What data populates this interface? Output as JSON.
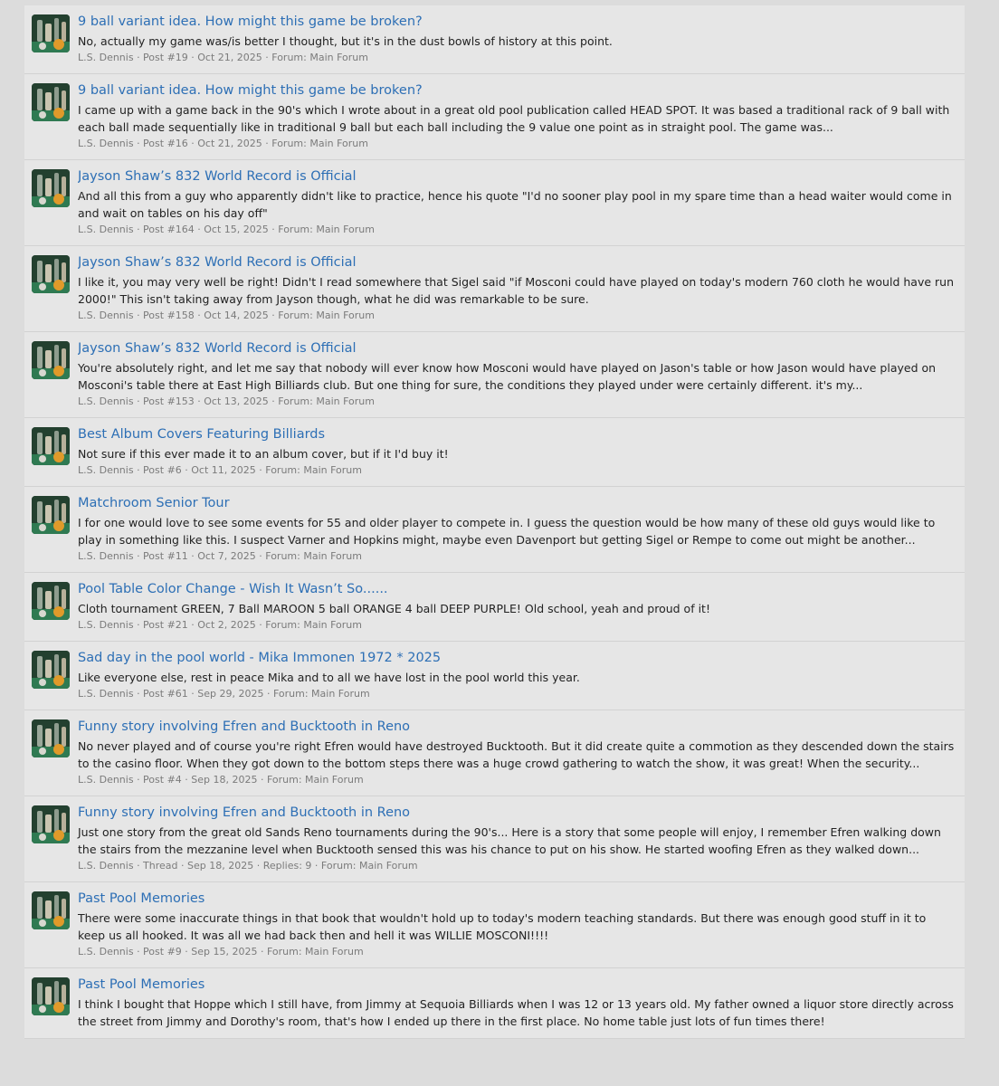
{
  "results": [
    {
      "title": "9 ball variant idea. How might this game be broken?",
      "snippet": "No, actually my game was/is better I thought, but it's in the dust bowls of history at this point.",
      "meta": "L.S. Dennis · Post #19 · Oct 21, 2025 · Forum: Main Forum"
    },
    {
      "title": "9 ball variant idea. How might this game be broken?",
      "snippet": "I came up with a game back in the 90's which I wrote about in a great old pool publication called HEAD SPOT. It was based a traditional rack of 9 ball with each ball made sequentially like in traditional 9 ball but each ball including the 9 value one point as in straight pool. The game was...",
      "meta": "L.S. Dennis · Post #16 · Oct 21, 2025 · Forum: Main Forum"
    },
    {
      "title": "Jayson Shaw’s 832 World Record is Official",
      "snippet": "And all this from a guy who apparently didn't like to practice, hence his quote \"I'd no sooner play pool in my spare time than a head waiter would come in and wait on tables on his day off\"",
      "meta": "L.S. Dennis · Post #164 · Oct 15, 2025 · Forum: Main Forum"
    },
    {
      "title": "Jayson Shaw’s 832 World Record is Official",
      "snippet": "I like it, you may very well be right! Didn't I read somewhere that Sigel said \"if Mosconi could have played on today's modern 760 cloth he would have run 2000!\" This isn't taking away from Jayson though, what he did was remarkable to be sure.",
      "meta": "L.S. Dennis · Post #158 · Oct 14, 2025 · Forum: Main Forum"
    },
    {
      "title": "Jayson Shaw’s 832 World Record is Official",
      "snippet": "You're absolutely right, and let me say that nobody will ever know how Mosconi would have played on Jason's table or how Jason would have played on Mosconi's table there at East High Billiards club. But one thing for sure, the conditions they played under were certainly different. it's my...",
      "meta": "L.S. Dennis · Post #153 · Oct 13, 2025 · Forum: Main Forum"
    },
    {
      "title": "Best Album Covers Featuring Billiards",
      "snippet": "Not sure if this ever made it to an album cover, but if it I'd buy it!",
      "meta": "L.S. Dennis · Post #6 · Oct 11, 2025 · Forum: Main Forum"
    },
    {
      "title": "Matchroom Senior Tour",
      "snippet": "I for one would love to see some events for 55 and older player to compete in. I guess the question would be how many of these old guys would like to play in something like this. I suspect Varner and Hopkins might, maybe even Davenport but getting Sigel or Rempe to come out might be another...",
      "meta": "L.S. Dennis · Post #11 · Oct 7, 2025 · Forum: Main Forum"
    },
    {
      "title": "Pool Table Color Change - Wish It Wasn’t So......",
      "snippet": "Cloth tournament GREEN, 7 Ball MAROON 5 ball ORANGE 4 ball DEEP PURPLE! Old school, yeah and proud of it!",
      "meta": "L.S. Dennis · Post #21 · Oct 2, 2025 · Forum: Main Forum"
    },
    {
      "title": "Sad day in the pool world - Mika Immonen 1972 * 2025",
      "snippet": "Like everyone else, rest in peace Mika and to all we have lost in the pool world this year.",
      "meta": "L.S. Dennis · Post #61 · Sep 29, 2025 · Forum: Main Forum"
    },
    {
      "title": "Funny story involving Efren and Bucktooth in Reno",
      "snippet": "No never played and of course you're right Efren would have destroyed Bucktooth. But it did create quite a commotion as they descended down the stairs to the casino floor. When they got down to the bottom steps there was a huge crowd gathering to watch the show, it was great! When the security...",
      "meta": "L.S. Dennis · Post #4 · Sep 18, 2025 · Forum: Main Forum"
    },
    {
      "title": "Funny story involving Efren and Bucktooth in Reno",
      "snippet": "Just one story from the great old Sands Reno tournaments during the 90's... Here is a story that some people will enjoy, I remember Efren walking down the stairs from the mezzanine level when Bucktooth sensed this was his chance to put on his show. He started woofing Efren as they walked down...",
      "meta": "L.S. Dennis · Thread · Sep 18, 2025 · Replies: 9 · Forum: Main Forum"
    },
    {
      "title": "Past Pool Memories",
      "snippet": "There were some inaccurate things in that book that wouldn't hold up to today's modern teaching standards. But there was enough good stuff in it to keep us all hooked. It was all we had back then and hell it was WILLIE MOSCONI!!!!",
      "meta": "L.S. Dennis · Post #9 · Sep 15, 2025 · Forum: Main Forum"
    },
    {
      "title": "Past Pool Memories",
      "snippet": "I think I bought that Hoppe which I still have, from Jimmy at Sequoia Billiards when I was 12 or 13 years old. My father owned a liquor store directly across the street from Jimmy and Dorothy's room, that's how I ended up there in the first place. No home table just lots of fun times there!",
      "meta": ""
    }
  ]
}
